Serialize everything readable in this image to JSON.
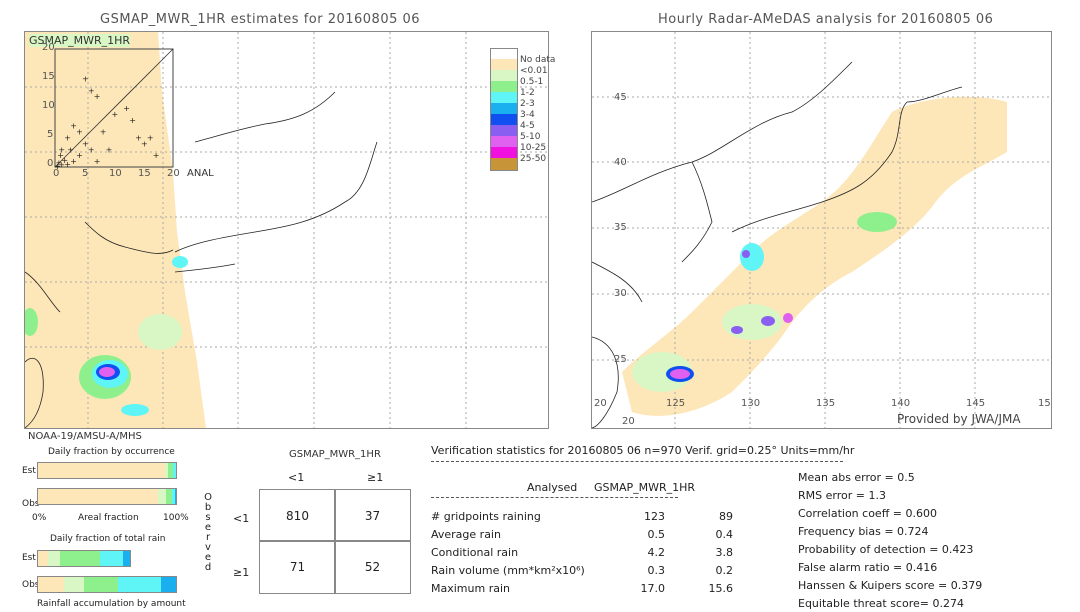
{
  "left_panel": {
    "title": "GSMAP_MWR_1HR estimates for 20160805 06",
    "inset_label": "GSMAP_MWR_1HR",
    "inset_x_label": "ANAL",
    "inset_ticks_x": [
      "0",
      "5",
      "10",
      "15",
      "20"
    ],
    "inset_ticks_y": [
      "0",
      "5",
      "10",
      "15",
      "20"
    ],
    "sensor": "NOAA-19/AMSU-A/MHS"
  },
  "right_panel": {
    "title": "Hourly Radar-AMeDAS analysis for 20160805 06",
    "credit": "Provided by JWA/JMA",
    "lon_ticks": [
      "20",
      "125",
      "130",
      "135",
      "140",
      "145",
      "15"
    ],
    "lat_ticks": [
      "45",
      "40",
      "35",
      "30",
      "25",
      "20"
    ]
  },
  "legend": {
    "items": [
      {
        "label": "No data",
        "color": "#ffffff"
      },
      {
        "label": "<0.01",
        "color": "#fde6b8"
      },
      {
        "label": "0.5-1",
        "color": "#d9f7c4"
      },
      {
        "label": "1-2",
        "color": "#8ef08c"
      },
      {
        "label": "2-3",
        "color": "#5ff5f7"
      },
      {
        "label": "3-4",
        "color": "#1ab0f0"
      },
      {
        "label": "4-5",
        "color": "#1050f0"
      },
      {
        "label": "5-10",
        "color": "#8a5ef0"
      },
      {
        "label": "10-25",
        "color": "#e060f0"
      },
      {
        "label": "25-50",
        "color": "#f010e0"
      },
      {
        "label": "",
        "color": "#c89438"
      }
    ]
  },
  "occurrence": {
    "title": "Daily fraction by occurrence",
    "est_label": "Est",
    "obs_label": "Obs",
    "axis_left": "0%",
    "axis_mid": "Areal fraction",
    "axis_right": "100%",
    "est_segments": [
      {
        "fraction": 0.92,
        "color": "#fde6b8"
      },
      {
        "fraction": 0.02,
        "color": "#d9f7c4"
      },
      {
        "fraction": 0.04,
        "color": "#8ef08c"
      },
      {
        "fraction": 0.02,
        "color": "#5ff5f7"
      }
    ],
    "obs_segments": [
      {
        "fraction": 0.87,
        "color": "#fde6b8"
      },
      {
        "fraction": 0.06,
        "color": "#d9f7c4"
      },
      {
        "fraction": 0.04,
        "color": "#8ef08c"
      },
      {
        "fraction": 0.02,
        "color": "#5ff5f7"
      },
      {
        "fraction": 0.01,
        "color": "#1ab0f0"
      }
    ]
  },
  "total_rain": {
    "title": "Daily fraction of total rain",
    "est_label": "Est",
    "obs_label": "Obs",
    "footer": "Rainfall accumulation by amount",
    "est_scale": 0.66,
    "est_segments": [
      {
        "fraction": 0.11,
        "color": "#fde6b8"
      },
      {
        "fraction": 0.13,
        "color": "#d9f7c4"
      },
      {
        "fraction": 0.43,
        "color": "#8ef08c"
      },
      {
        "fraction": 0.25,
        "color": "#5ff5f7"
      },
      {
        "fraction": 0.08,
        "color": "#1ab0f0"
      }
    ],
    "obs_segments": [
      {
        "fraction": 0.19,
        "color": "#fde6b8"
      },
      {
        "fraction": 0.14,
        "color": "#d9f7c4"
      },
      {
        "fraction": 0.25,
        "color": "#8ef08c"
      },
      {
        "fraction": 0.31,
        "color": "#5ff5f7"
      },
      {
        "fraction": 0.11,
        "color": "#1ab0f0"
      }
    ]
  },
  "contingency": {
    "title": "GSMAP_MWR_1HR",
    "col_headers": [
      "<1",
      "≥1"
    ],
    "row_headers": [
      "<1",
      "≥1"
    ],
    "side_label": "Observed",
    "cells": [
      [
        "810",
        "37"
      ],
      [
        "71",
        "52"
      ]
    ]
  },
  "verification": {
    "header": "Verification statistics for 20160805 06   n=970   Verif. grid=0.25°   Units=mm/hr",
    "col_analysed": "Analysed",
    "col_model": "GSMAP_MWR_1HR",
    "rows": [
      {
        "label": "# gridpoints raining",
        "analysed": "123",
        "model": "89"
      },
      {
        "label": "Average rain",
        "analysed": "0.5",
        "model": "0.4"
      },
      {
        "label": "Conditional rain",
        "analysed": "4.2",
        "model": "3.8"
      },
      {
        "label": "Rain volume (mm*km²x10⁶)",
        "analysed": "0.3",
        "model": "0.2"
      },
      {
        "label": "Maximum rain",
        "analysed": "17.0",
        "model": "15.6"
      }
    ],
    "scores": [
      "Mean abs error = 0.5",
      "RMS error = 1.3",
      "Correlation coeff = 0.600",
      "Frequency bias = 0.724",
      "Probability of detection = 0.423",
      "False alarm ratio = 0.416",
      "Hanssen & Kuipers score = 0.379",
      "Equitable threat score= 0.274"
    ]
  },
  "chart_data": {
    "type": "table",
    "title": "Verification statistics for 20160805 06",
    "contingency_table": {
      "rows": [
        "Observed <1",
        "Observed ≥1"
      ],
      "columns": [
        "GSMAP <1",
        "GSMAP ≥1"
      ],
      "values": [
        [
          810,
          37
        ],
        [
          71,
          52
        ]
      ]
    },
    "n": 970,
    "grid_deg": 0.25,
    "units": "mm/hr",
    "statistics": {
      "gridpoints_raining": {
        "analysed": 123,
        "gsmap": 89
      },
      "average_rain": {
        "analysed": 0.5,
        "gsmap": 0.4
      },
      "conditional_rain": {
        "analysed": 4.2,
        "gsmap": 3.8
      },
      "rain_volume": {
        "analysed": 0.3,
        "gsmap": 0.2
      },
      "maximum_rain": {
        "analysed": 17.0,
        "gsmap": 15.6
      }
    },
    "scores": {
      "mean_abs_error": 0.5,
      "rms_error": 1.3,
      "correlation_coeff": 0.6,
      "frequency_bias": 0.724,
      "probability_of_detection": 0.423,
      "false_alarm_ratio": 0.416,
      "hanssen_kuipers": 0.379,
      "equitable_threat_score": 0.274
    },
    "scatter_inset": {
      "xlabel": "ANAL",
      "ylabel": "GSMAP_MWR_1HR",
      "xlim": [
        0,
        20
      ],
      "ylim": [
        0,
        20
      ]
    }
  }
}
